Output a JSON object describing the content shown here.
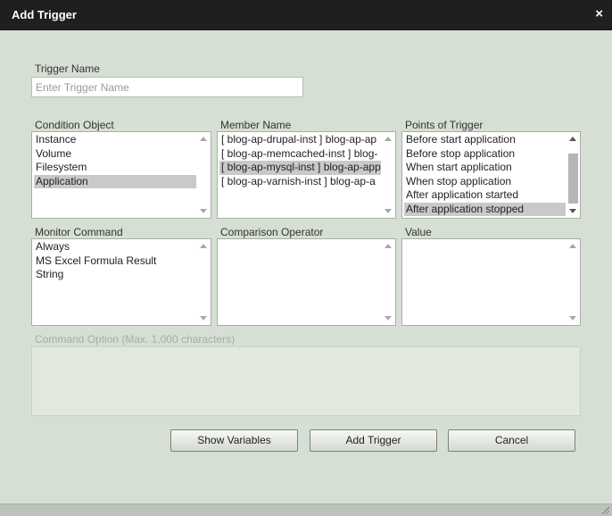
{
  "window": {
    "title": "Add Trigger",
    "close_glyph": "×"
  },
  "trigger_name": {
    "label": "Trigger Name",
    "placeholder": "Enter Trigger Name",
    "value": ""
  },
  "condition_object": {
    "label": "Condition Object",
    "items": [
      "Instance",
      "Volume",
      "Filesystem",
      "Application"
    ],
    "selected": "Application"
  },
  "member_name": {
    "label": "Member Name",
    "items": [
      "[ blog-ap-drupal-inst ] blog-ap-ap",
      "[ blog-ap-memcached-inst ] blog-",
      "[ blog-ap-mysql-inst ] blog-ap-app",
      "[ blog-ap-varnish-inst ] blog-ap-a"
    ],
    "selected": "[ blog-ap-mysql-inst ] blog-ap-app"
  },
  "points_of_trigger": {
    "label": "Points of Trigger",
    "items": [
      "Before start application",
      "Before stop application",
      "When start application",
      "When stop application",
      "After application started",
      "After application stopped"
    ],
    "selected": "After application stopped"
  },
  "monitor_command": {
    "label": "Monitor Command",
    "items": [
      "Always",
      "MS Excel Formula Result",
      "String"
    ]
  },
  "comparison_operator": {
    "label": "Comparison Operator",
    "items": []
  },
  "value": {
    "label": "Value",
    "items": []
  },
  "command_option": {
    "label": "Command Option (Max. 1,000 characters)"
  },
  "buttons": {
    "show_variables": "Show Variables",
    "add_trigger": "Add Trigger",
    "cancel": "Cancel"
  },
  "icons": {
    "close": "close-icon",
    "scroll_up": "chevron-up-icon",
    "scroll_down": "chevron-down-icon",
    "resize": "resize-grip-icon"
  }
}
